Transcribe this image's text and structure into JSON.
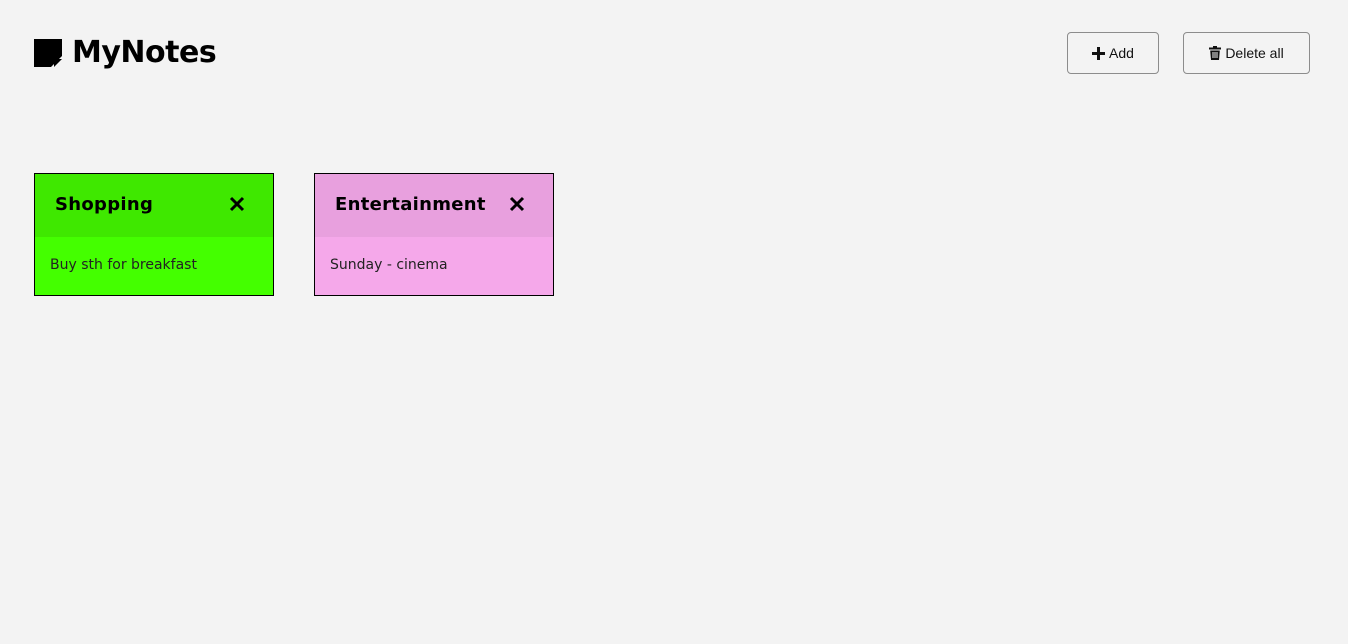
{
  "app": {
    "title": "MyNotes",
    "logo_icon": "sticky-note-icon"
  },
  "toolbar": {
    "add_label": "Add",
    "add_icon": "plus-icon",
    "delete_all_label": "Delete all",
    "delete_all_icon": "trash-icon"
  },
  "notes": [
    {
      "title": "Shopping",
      "body": "Buy sth for breakfast",
      "header_color": "#3fe800",
      "body_color": "#44ff00",
      "close_icon": "close-icon"
    },
    {
      "title": "Entertainment",
      "body": "Sunday - cinema",
      "header_color": "#e8a0de",
      "body_color": "#f5a8ea",
      "close_icon": "close-icon"
    }
  ],
  "colors": {
    "background": "#f3f3f3",
    "button_border": "#8c8c8c"
  }
}
